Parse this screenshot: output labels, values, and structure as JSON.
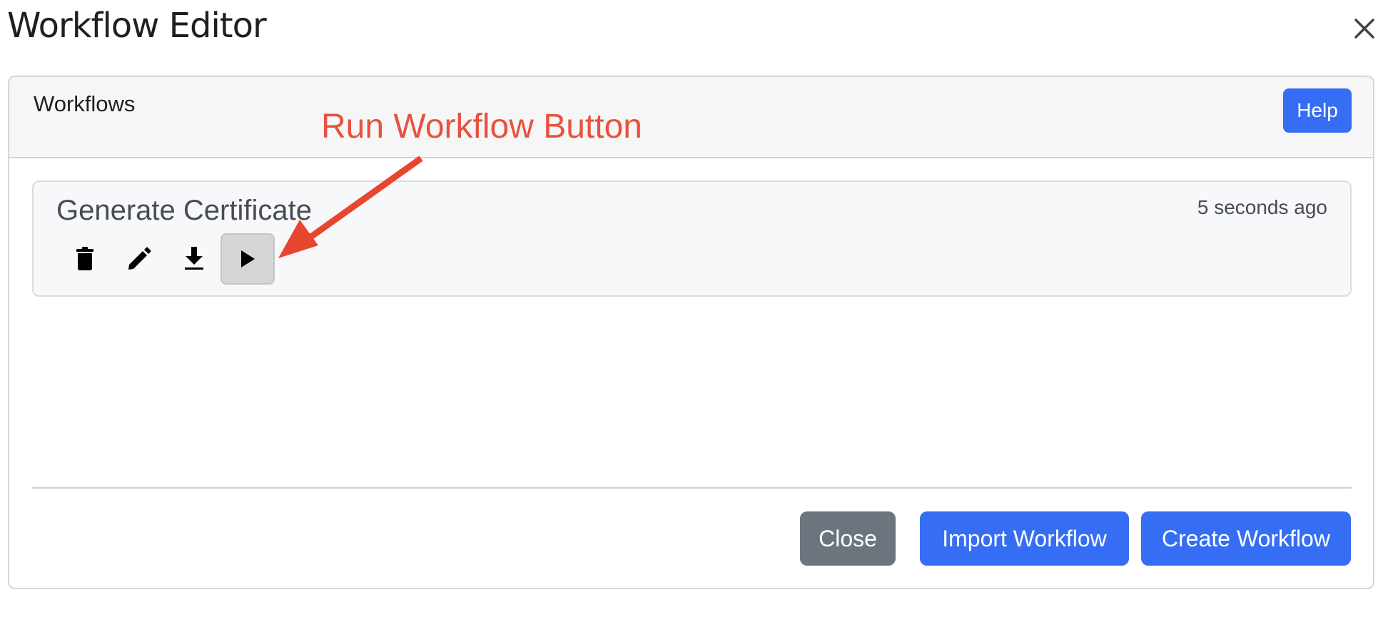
{
  "dialog": {
    "title": "Workflow Editor",
    "close_icon": "close-icon"
  },
  "panel": {
    "header_title": "Workflows",
    "help_label": "Help"
  },
  "workflows": [
    {
      "name": "Generate Certificate",
      "updated": "5 seconds ago",
      "actions": [
        {
          "icon": "trash-icon",
          "label": "Delete"
        },
        {
          "icon": "pencil-icon",
          "label": "Edit"
        },
        {
          "icon": "download-icon",
          "label": "Export"
        },
        {
          "icon": "play-icon",
          "label": "Run"
        }
      ]
    }
  ],
  "annotation": {
    "text": "Run Workflow Button",
    "color": "#e8513f"
  },
  "footer": {
    "close_label": "Close",
    "import_label": "Import Workflow",
    "create_label": "Create Workflow"
  },
  "colors": {
    "primary": "#356ef4",
    "secondary": "#6c757d"
  }
}
